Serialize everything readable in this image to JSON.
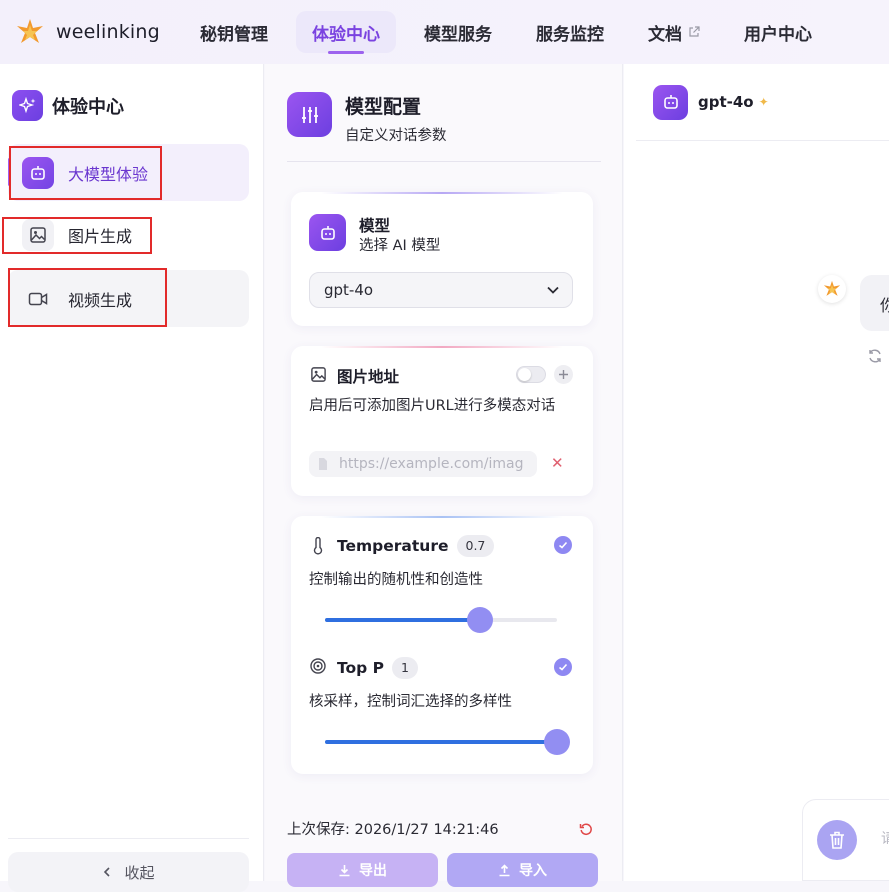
{
  "brand": {
    "name": "weelinking"
  },
  "nav": {
    "items": [
      {
        "label": "秘钥管理"
      },
      {
        "label": "体验中心"
      },
      {
        "label": "模型服务"
      },
      {
        "label": "服务监控"
      },
      {
        "label": "文档"
      },
      {
        "label": "用户中心"
      }
    ],
    "active_index": 1
  },
  "sidebar": {
    "title": "体验中心",
    "items": [
      {
        "label": "大模型体验",
        "icon": "robot-icon"
      },
      {
        "label": "图片生成",
        "icon": "image-icon"
      },
      {
        "label": "视频生成",
        "icon": "video-icon"
      }
    ],
    "collapse_label": "收起"
  },
  "config": {
    "title": "模型配置",
    "subtitle": "自定义对话参数",
    "model_card": {
      "title": "模型",
      "subtitle": "选择 AI 模型",
      "selected": "gpt-4o"
    },
    "image_card": {
      "title": "图片地址",
      "description": "启用后可添加图片URL进行多模态对话",
      "placeholder": "https://example.com/imag",
      "enabled": false
    },
    "temperature": {
      "label": "Temperature",
      "value": "0.7",
      "description": "控制输出的随机性和创造性",
      "fraction": 0.67
    },
    "top_p": {
      "label": "Top P",
      "value": "1",
      "description": "核采样，控制词汇选择的多样性",
      "fraction": 1.0
    },
    "last_saved": "上次保存: 2026/1/27 14:21:46",
    "export_label": "导出",
    "import_label": "导入"
  },
  "chat": {
    "model": "gpt-4o",
    "bubble_text": "你",
    "input_placeholder": "请"
  },
  "colors": {
    "accent": "#7a43e0",
    "annotation_box": "#e22a2a",
    "slider_fill": "#2f6fe0",
    "slider_thumb": "#928ef2"
  }
}
